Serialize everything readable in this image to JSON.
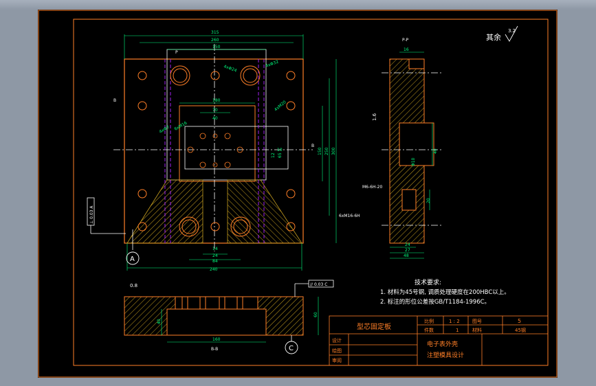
{
  "title_block": {
    "part_name": "型芯固定板",
    "scale_label": "比例",
    "scale_value": "1 : 2",
    "drawing_no_label": "图号",
    "drawing_no_value": "5",
    "qty_label": "件数",
    "qty_value": "1",
    "material_label": "材料",
    "material_value": "45钢",
    "design_label": "设计",
    "drawn_label": "绘图",
    "review_label": "审阅",
    "project_line1": "电子表外壳",
    "project_line2": "注塑模具设计"
  },
  "notes": {
    "heading": "技术要求:",
    "item1": "1. 材料为45号钢, 调质处理硬度在200HBC以上。",
    "item2": "2. 标注的形位公差按GB/T1184-1996C。"
  },
  "roughness": {
    "rest_label": "其余",
    "rest_value": "3.2",
    "side_value": "1.6",
    "bottom_value": "0.8"
  },
  "datums": {
    "a": "A",
    "c": "C"
  },
  "tolerance_frames": {
    "left": "⊥ 0.03 A",
    "bottom": "// 0.03 C"
  },
  "section_labels": {
    "top_view_p": "P",
    "top_view_b": "B",
    "side_section": "P-P",
    "bottom_section": "B-B"
  },
  "dimensions": {
    "top_overall": "315",
    "top_260": "260",
    "top_150": "150",
    "small_180": "180",
    "small_70": "70",
    "small_40": "40",
    "small_10": "10",
    "right_150": "150",
    "right_250": "250",
    "right_300": "300",
    "right_B": "B",
    "mid_12": "12",
    "mid_65": "65",
    "bot_24": "24",
    "bot_84": "84",
    "bot_240": "240",
    "bot_14": "14",
    "holes_4x_phi24": "4xΦ24",
    "holes_4x_phi32": "4xΦ32",
    "holes_4x_phi7": "4xΦ7",
    "holes_4x_m20": "4xM20",
    "note_6x_m16": "6xM16",
    "side_16": "16",
    "side_40": "40",
    "side_phi10": "Φ10",
    "side_m6": "M6-6H-20",
    "side_m16": "6xM16-6H",
    "side_24": "24",
    "side_27": "27",
    "side_48": "48",
    "side_20": "20",
    "sec_40": "40",
    "sec_60": "60",
    "sec_160": "160"
  },
  "colors": {
    "background": "#000000",
    "frame": "#ff7f27",
    "outline_part": "#ff7f27",
    "dimension": "#00ff7f",
    "hidden_line": "#a020f0",
    "hatch": "#c8a020",
    "text_white": "#ffffff",
    "title_text": "#ff7f27"
  }
}
